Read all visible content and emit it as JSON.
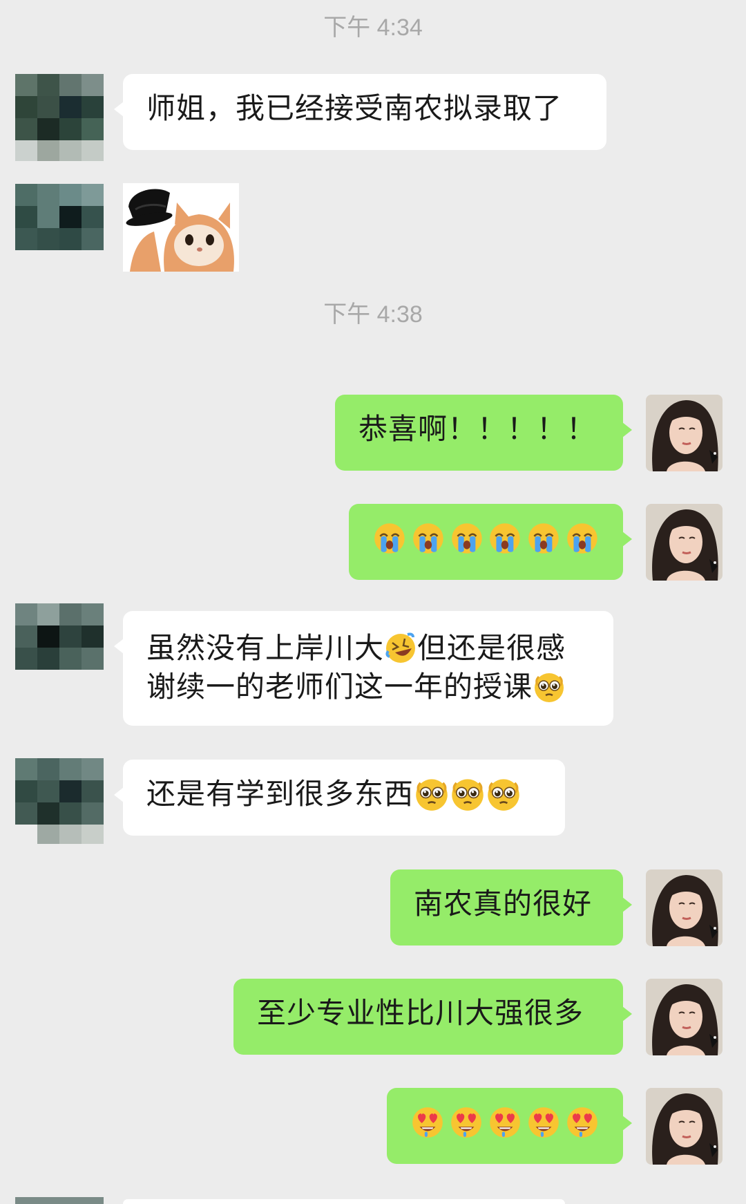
{
  "timestamps": [
    "下午 4:34",
    "下午 4:38"
  ],
  "messages": {
    "m1": "师姐，我已经接受南农拟录取了",
    "m3": "恭喜啊！！！！！",
    "m5_line1a": "虽然没有上岸川大",
    "m5_line1b": "但还是很感",
    "m5_line2": "谢续一的老师们这一年的授课",
    "m6": "还是有学到很多东西",
    "m7": "南农真的很好",
    "m8": "至少专业性比川大强很多"
  },
  "emoji": {
    "m4": [
      "loudly-crying-face",
      "loudly-crying-face",
      "loudly-crying-face",
      "loudly-crying-face",
      "loudly-crying-face",
      "loudly-crying-face"
    ],
    "m5_inline": [
      "rolling-on-floor-laughing-face",
      "pleading-face"
    ],
    "m6": [
      "pleading-face",
      "pleading-face",
      "pleading-face"
    ],
    "m9": [
      "heart-eyes-face",
      "heart-eyes-face",
      "heart-eyes-face",
      "heart-eyes-face",
      "heart-eyes-face"
    ]
  },
  "colors": {
    "background": "#ececec",
    "incoming_bubble": "#ffffff",
    "outgoing_bubble": "#95ec69",
    "timestamp": "#a8a8a8"
  }
}
